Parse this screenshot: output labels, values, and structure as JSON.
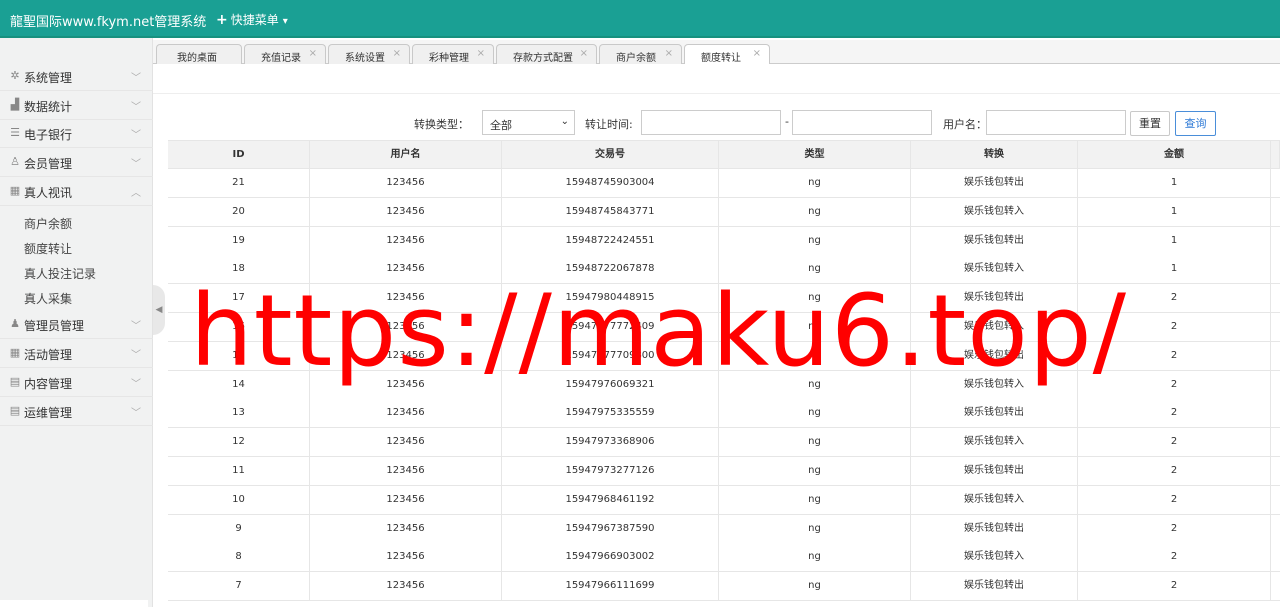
{
  "header": {
    "brand": "龍聖国际www.fkym.net管理系统",
    "quick_menu": "快捷菜单"
  },
  "sidebar": {
    "items": [
      {
        "label": "系统管理",
        "icon": "gear-icon"
      },
      {
        "label": "数据统计",
        "icon": "bar-chart-icon"
      },
      {
        "label": "电子银行",
        "icon": "list-icon"
      },
      {
        "label": "会员管理",
        "icon": "user-icon"
      },
      {
        "label": "真人视讯",
        "icon": "grid-icon"
      },
      {
        "label": "管理员管理",
        "icon": "admin-icon"
      },
      {
        "label": "活动管理",
        "icon": "grid-icon"
      },
      {
        "label": "内容管理",
        "icon": "document-icon"
      },
      {
        "label": "运维管理",
        "icon": "document-icon"
      }
    ],
    "subitems": [
      "商户余额",
      "额度转让",
      "真人投注记录",
      "真人采集"
    ]
  },
  "tabs": [
    "我的桌面",
    "充值记录",
    "系统设置",
    "彩种管理",
    "存款方式配置",
    "商户余额",
    "额度转让"
  ],
  "active_tab": "额度转让",
  "filters": {
    "type_label": "转换类型：",
    "type_value": "全部",
    "time_label": "转让时间:",
    "time_sep": "-",
    "user_label": "用户名：",
    "reset": "重置",
    "search": "查询"
  },
  "table": {
    "columns": [
      "ID",
      "用户名",
      "交易号",
      "类型",
      "转换",
      "金额"
    ],
    "rows": [
      [
        "21",
        "123456",
        "15948745903004",
        "ng",
        "娱乐钱包转出",
        "1"
      ],
      [
        "20",
        "123456",
        "15948745843771",
        "ng",
        "娱乐钱包转入",
        "1"
      ],
      [
        "19",
        "123456",
        "15948722424551",
        "ng",
        "娱乐钱包转出",
        "1"
      ],
      [
        "18",
        "123456",
        "15948722067878",
        "ng",
        "娱乐钱包转入",
        "1"
      ],
      [
        "17",
        "123456",
        "15947980448915",
        "ng",
        "娱乐钱包转出",
        "2"
      ],
      [
        "16",
        "123456",
        "15947977772409",
        "ng",
        "娱乐钱包转入",
        "2"
      ],
      [
        "15",
        "123456",
        "15947977709800",
        "ng",
        "娱乐钱包转出",
        "2"
      ],
      [
        "14",
        "123456",
        "15947976069321",
        "ng",
        "娱乐钱包转入",
        "2"
      ],
      [
        "13",
        "123456",
        "15947975335559",
        "ng",
        "娱乐钱包转出",
        "2"
      ],
      [
        "12",
        "123456",
        "15947973368906",
        "ng",
        "娱乐钱包转入",
        "2"
      ],
      [
        "11",
        "123456",
        "15947973277126",
        "ng",
        "娱乐钱包转出",
        "2"
      ],
      [
        "10",
        "123456",
        "15947968461192",
        "ng",
        "娱乐钱包转入",
        "2"
      ],
      [
        "9",
        "123456",
        "15947967387590",
        "ng",
        "娱乐钱包转出",
        "2"
      ],
      [
        "8",
        "123456",
        "15947966903002",
        "ng",
        "娱乐钱包转入",
        "2"
      ],
      [
        "7",
        "123456",
        "15947966111699",
        "ng",
        "娱乐钱包转出",
        "2"
      ]
    ]
  },
  "watermark": "https://maku6.top/",
  "colors": {
    "header": "#1aa094",
    "watermark": "#ff0000",
    "primary_button": "#2e7ad6"
  }
}
